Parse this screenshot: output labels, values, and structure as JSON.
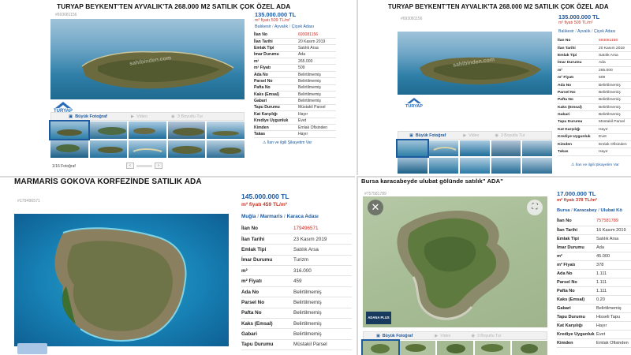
{
  "listings": [
    {
      "title": "TURYAP BEYKENT'TEN AYVALIK'TA 268.000 M2 SATILIK ÇOK ÖZEL ADA",
      "ref": "#693081156",
      "price": "135.000.000 TL",
      "price_sqm_label": "m² fiyatı",
      "price_sqm": "509 TL/m²",
      "location": [
        "Balıkesir",
        "Ayvalık",
        "Çiçek Adası"
      ],
      "rows": [
        {
          "k": "İlan No",
          "v": "693081156"
        },
        {
          "k": "İlan Tarihi",
          "v": "20 Kasım 2019"
        },
        {
          "k": "Emlak Tipi",
          "v": "Satılık Arsa"
        },
        {
          "k": "İmar Durumu",
          "v": "Ada"
        },
        {
          "k": "m²",
          "v": "265.000"
        },
        {
          "k": "m² Fiyatı",
          "v": "509"
        },
        {
          "k": "Ada No",
          "v": "Belirtilmemiş"
        },
        {
          "k": "Parsel No",
          "v": "Belirtilmemiş"
        },
        {
          "k": "Pafta No",
          "v": "Belirtilmemiş"
        },
        {
          "k": "Kaks (Emsal)",
          "v": "Belirtilmemiş"
        },
        {
          "k": "Gabari",
          "v": "Belirtilmemiş"
        },
        {
          "k": "Tapu Durumu",
          "v": "Müstakil Parsel"
        },
        {
          "k": "Kat Karşılığı",
          "v": "Hayır"
        },
        {
          "k": "Krediye Uygunluk",
          "v": "Evet"
        },
        {
          "k": "Kimden",
          "v": "Emlak Ofisinden"
        },
        {
          "k": "Takas",
          "v": "Hayır"
        }
      ],
      "tabs": {
        "photos": "Büyük Fotoğraf",
        "video": "Video",
        "vr": "3 Boyutlu Tur"
      },
      "logo": "TURYAP",
      "report_link": "İlan ve ilgili Şikayetim Var",
      "pager": "1/16 Fotoğraf"
    },
    {
      "title": "TURYAP BEYKENT'TEN AYVALIK'TA 268.000 M2 SATILIK ÇOK ÖZEL ADA",
      "ref": "#693081156",
      "price": "135.000.000 TL",
      "price_sqm_label": "m² fiyatı",
      "price_sqm": "509 TL/m²",
      "location": [
        "Balıkesir",
        "Ayvalık",
        "Çiçek Adası"
      ],
      "rows": [
        {
          "k": "İlan No",
          "v": "693081156"
        },
        {
          "k": "İlan Tarihi",
          "v": "20 Kasım 2019"
        },
        {
          "k": "Emlak Tipi",
          "v": "Satılık Arsa"
        },
        {
          "k": "İmar Durumu",
          "v": "Ada"
        },
        {
          "k": "m²",
          "v": "265.000"
        },
        {
          "k": "m² Fiyatı",
          "v": "509"
        },
        {
          "k": "Ada No",
          "v": "Belirtilmemiş"
        },
        {
          "k": "Parsel No",
          "v": "Belirtilmemiş"
        },
        {
          "k": "Pafta No",
          "v": "Belirtilmemiş"
        },
        {
          "k": "Kaks (Emsal)",
          "v": "Belirtilmemiş"
        },
        {
          "k": "Gabari",
          "v": "Belirtilmemiş"
        },
        {
          "k": "Tapu Durumu",
          "v": "Müstakil Parsel"
        },
        {
          "k": "Kat Karşılığı",
          "v": "Hayır"
        },
        {
          "k": "Krediye Uygunluk",
          "v": "Evet"
        },
        {
          "k": "Kimden",
          "v": "Emlak Ofisinden"
        },
        {
          "k": "Takas",
          "v": "Hayır"
        }
      ],
      "tabs": {
        "photos": "Büyük Fotoğraf",
        "video": "Video",
        "vr": "3 Boyutlu Tur"
      },
      "logo": "TURYAP",
      "report_link": "İlan ve ilgili Şikayetim Var"
    },
    {
      "title": "MARMARİS GÖKOVA KÖRFEZİNDE SATILIK ADA",
      "ref": "#179496571",
      "price": "145.000.000 TL",
      "price_sqm_label": "m² fiyatı",
      "price_sqm": "459 TL/m²",
      "location": [
        "Muğla",
        "Marmaris",
        "Karaca Adası"
      ],
      "rows": [
        {
          "k": "İlan No",
          "v": "179496571"
        },
        {
          "k": "İlan Tarihi",
          "v": "23 Kasım 2019"
        },
        {
          "k": "Emlak Tipi",
          "v": "Satılık Arsa"
        },
        {
          "k": "İmar Durumu",
          "v": "Turizm"
        },
        {
          "k": "m²",
          "v": "316.000"
        },
        {
          "k": "m² Fiyatı",
          "v": "459"
        },
        {
          "k": "Ada No",
          "v": "Belirtilmemiş"
        },
        {
          "k": "Parsel No",
          "v": "Belirtilmemiş"
        },
        {
          "k": "Pafta No",
          "v": "Belirtilmemiş"
        },
        {
          "k": "Kaks (Emsal)",
          "v": "Belirtilmemiş"
        },
        {
          "k": "Gabari",
          "v": "Belirtilmemiş"
        },
        {
          "k": "Tapu Durumu",
          "v": "Müstakil Parsel"
        }
      ]
    },
    {
      "title": "Bursa karacabeyde ulubat gölünde satılık\" ADA\"",
      "ref": "#757581789",
      "price": "17.000.000 TL",
      "price_sqm_label": "m² fiyatı",
      "price_sqm": "378 TL/m²",
      "location": [
        "Bursa",
        "Karacabey",
        "Ulubat Kö"
      ],
      "rows": [
        {
          "k": "İlan No",
          "v": "757581789"
        },
        {
          "k": "İlan Tarihi",
          "v": "16 Kasım 2019"
        },
        {
          "k": "Emlak Tipi",
          "v": "Satılık Arsa"
        },
        {
          "k": "İmar Durumu",
          "v": "Ada"
        },
        {
          "k": "m²",
          "v": "45.000"
        },
        {
          "k": "m² Fiyatı",
          "v": "378"
        },
        {
          "k": "Ada No",
          "v": "1.111"
        },
        {
          "k": "Parsel No",
          "v": "1.111"
        },
        {
          "k": "Pafta No",
          "v": "1.111"
        },
        {
          "k": "Kaks (Emsal)",
          "v": "0.20"
        },
        {
          "k": "Gabari",
          "v": "Belirtilmemiş"
        },
        {
          "k": "Tapu Durumu",
          "v": "Hisseli Tapu"
        },
        {
          "k": "Kat Karşılığı",
          "v": "Hayır"
        },
        {
          "k": "Krediye Uygunluk",
          "v": "Evet"
        },
        {
          "k": "Kimden",
          "v": "Emlak Ofisinden"
        }
      ],
      "tabs": {
        "photos": "Büyük Fotoğraf",
        "video": "Video",
        "vr": "3 Boyutlu Tur"
      },
      "logo": "ADANA PLUS"
    }
  ],
  "watermark": "sahibinden.com",
  "colors": {
    "link_blue": "#1d5aa0",
    "price_red": "#c0392b",
    "id_red": "#d4261d"
  },
  "icons": {
    "camera": "camera-icon",
    "video": "video-icon",
    "vr": "vr-icon",
    "close": "close-icon",
    "expand": "expand-icon"
  }
}
